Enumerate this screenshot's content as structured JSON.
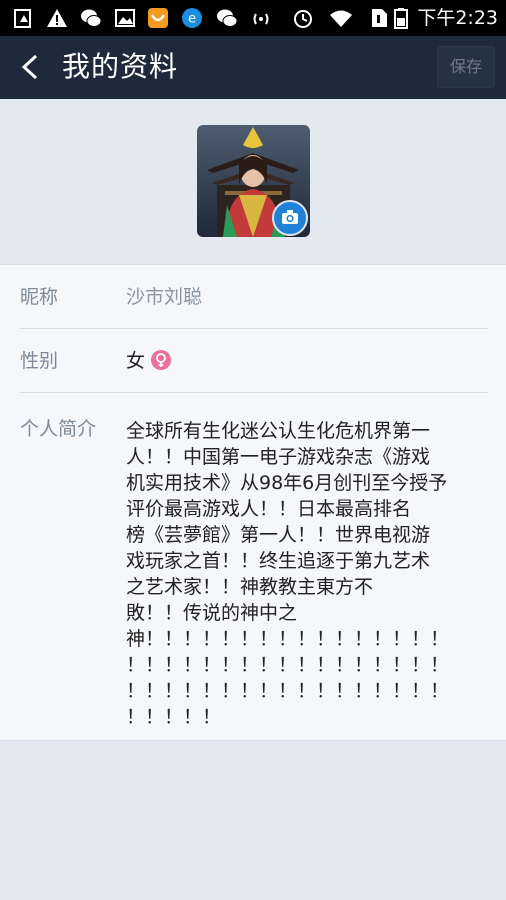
{
  "status_bar": {
    "time": "下午2:23",
    "icons": [
      "alert-upload-icon",
      "warning-icon",
      "wechat-icon",
      "image-icon",
      "uc-browser-icon",
      "e-icon",
      "wechat-icon-2",
      "signal-icon",
      "alarm-icon",
      "wifi-icon",
      "sim-icon",
      "battery-icon"
    ]
  },
  "header": {
    "back_icon": "back-arrow-icon",
    "title": "我的资料",
    "save_label": "保存"
  },
  "avatar": {
    "camera_icon": "camera-icon"
  },
  "profile": {
    "nickname_label": "昵称",
    "nickname_value": "沙市刘聪",
    "gender_label": "性别",
    "gender_value": "女",
    "gender_icon": "female-icon",
    "bio_label": "个人简介",
    "bio_lines": [
      "全球所有生化迷公认生化危机界第一",
      "人！！中国第一电子游戏杂志《游戏",
      "机实用技术》从98年6月创刊至今授予",
      "评价最高游戏人！！日本最高排名",
      "榜《芸夢館》第一人！！世界电视游",
      "戏玩家之首！！终生追逐于第九艺术",
      "之艺术家！！神教教主東方不",
      "敗！！传说的神中之",
      "神！！！！！！！！！！！！！！！！",
      "！！！！！！！！！！！！！！！！！",
      "！！！！！！！！！！！！！！！！！",
      "！！！！！"
    ]
  },
  "colors": {
    "header_bg": "#1e2a3b",
    "accent_blue": "#1f82d6",
    "female_pink": "#ee6f9a"
  }
}
